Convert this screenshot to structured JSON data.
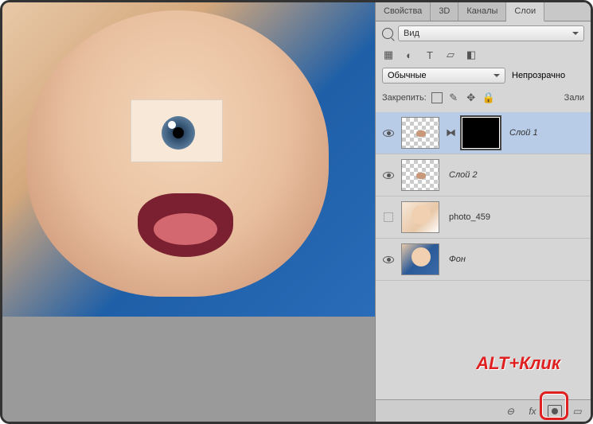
{
  "tabs": {
    "properties": "Свойства",
    "threed": "3D",
    "channels": "Каналы",
    "layers": "Слои"
  },
  "filter": {
    "kind_label": "Вид"
  },
  "blend": {
    "mode": "Обычные",
    "opacity_label": "Непрозрачно"
  },
  "lock": {
    "label": "Закрепить:",
    "fill_label": "Зали"
  },
  "layers_list": [
    {
      "name": "Слой 1",
      "has_mask": true,
      "selected": true,
      "visible": true
    },
    {
      "name": "Слой 2",
      "has_mask": false,
      "selected": false,
      "visible": true
    },
    {
      "name": "photo_459",
      "has_mask": false,
      "selected": false,
      "visible": false
    },
    {
      "name": "Фон",
      "has_mask": false,
      "selected": false,
      "visible": true
    }
  ],
  "annotation": "ALT+Клик",
  "icons": {
    "link": "⊖",
    "fx": "fx",
    "folder": "▭"
  }
}
